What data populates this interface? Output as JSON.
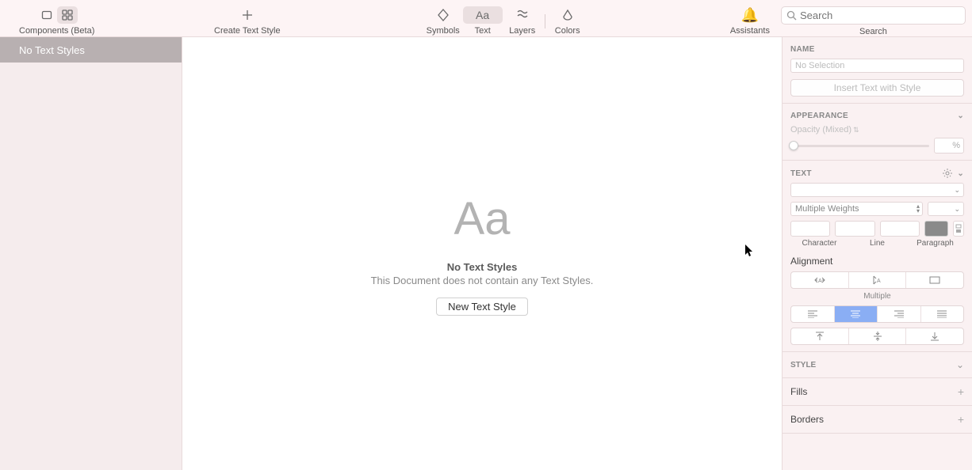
{
  "toolbar": {
    "components_label": "Components (Beta)",
    "create_label": "Create Text Style",
    "symbols": "Symbols",
    "text": "Text",
    "layers": "Layers",
    "colors": "Colors",
    "assistants": "Assistants",
    "search_placeholder": "Search",
    "search_label": "Search"
  },
  "sidebar": {
    "item0": "No Text Styles"
  },
  "canvas": {
    "aa": "Aa",
    "title": "No Text Styles",
    "subtitle": "This Document does not contain any Text Styles.",
    "button": "New Text Style"
  },
  "inspector": {
    "name_header": "NAME",
    "name_placeholder": "No Selection",
    "insert_btn": "Insert Text with Style",
    "appearance_header": "APPEARANCE",
    "opacity_label": "Opacity (Mixed)",
    "pct": "%",
    "text_header": "TEXT",
    "weights": "Multiple Weights",
    "char": "Character",
    "line": "Line",
    "para": "Paragraph",
    "alignment": "Alignment",
    "multiple": "Multiple",
    "style_header": "STYLE",
    "fills": "Fills",
    "borders": "Borders"
  }
}
